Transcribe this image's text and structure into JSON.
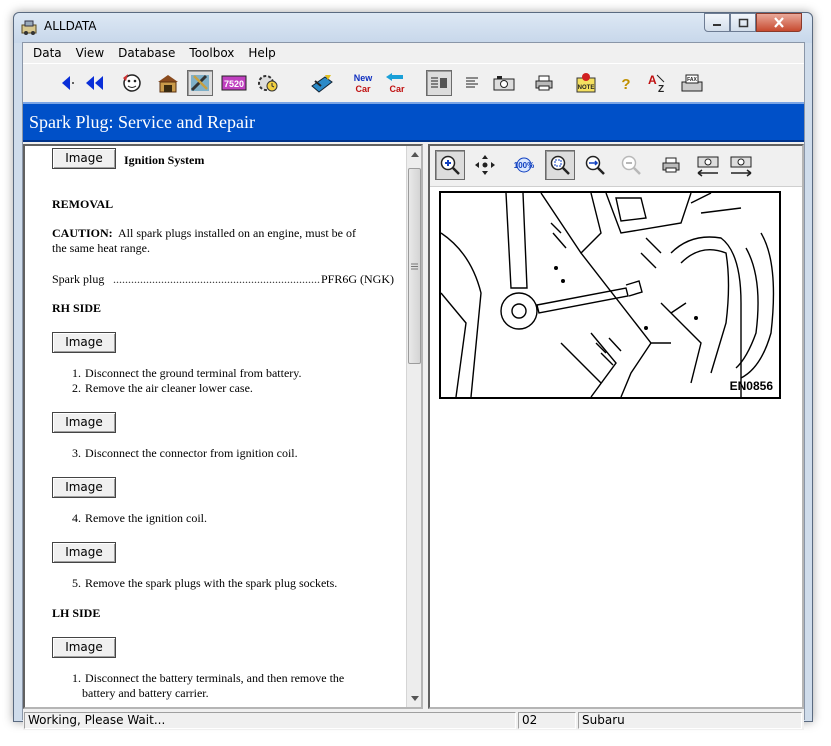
{
  "window": {
    "title": "ALLDATA",
    "app_icon": "alldata-app-icon"
  },
  "menu": [
    {
      "label": "Data"
    },
    {
      "label": "View"
    },
    {
      "label": "Database"
    },
    {
      "label": "Toolbox"
    },
    {
      "label": "Help"
    }
  ],
  "toolbar": {
    "buttons": [
      {
        "icon": "back-arrow-icon"
      },
      {
        "icon": "back-to-start-icon"
      },
      {
        "icon": "technician-face-icon"
      },
      {
        "icon": "garage-icon"
      },
      {
        "icon": "repair-tools-icon",
        "pressed": true
      },
      {
        "icon": "form-7520-icon",
        "text": "7520"
      },
      {
        "icon": "gear-clock-icon"
      },
      {
        "icon": "vehicle-selection-icon"
      },
      {
        "icon": "new-car-icon",
        "text": "New Car"
      },
      {
        "icon": "previous-car-icon",
        "text": "Car"
      },
      {
        "icon": "text-and-image-view-icon",
        "pressed": true
      },
      {
        "icon": "text-view-icon"
      },
      {
        "icon": "image-view-icon"
      },
      {
        "icon": "print-icon"
      },
      {
        "icon": "note-icon",
        "text": "NOTE"
      },
      {
        "icon": "help-icon"
      },
      {
        "icon": "a-to-z-index-icon"
      },
      {
        "icon": "fax-icon",
        "text": "FAX"
      }
    ]
  },
  "document": {
    "title": "Spark Plug:  Service and Repair",
    "image_button_label": "Image",
    "system": "Ignition System",
    "removal_heading": "REMOVAL",
    "caution": "CAUTION:  All spark plugs installed on an engine, must be of the same heat range.",
    "caution_line1": "CAUTION:  All spark plugs installed on an engine, must be of",
    "caution_line2": "the same heat range.",
    "spec_label": "Spark plug",
    "spec_value": "PFR6G (NGK)",
    "rh_heading": "RH SIDE",
    "lh_heading": "LH SIDE",
    "steps": [
      {
        "num": "1.",
        "text": "Disconnect the ground terminal from battery."
      },
      {
        "num": "2.",
        "text": "Remove the air cleaner lower case."
      },
      {
        "num": "3.",
        "text": "Disconnect the connector from ignition coil."
      },
      {
        "num": "4.",
        "text": "Remove the ignition coil."
      },
      {
        "num": "5.",
        "text": "Remove the spark plugs with the spark plug sockets."
      }
    ],
    "lh_steps": [
      {
        "num": "1.",
        "line1": "Disconnect the battery terminals, and then remove the",
        "line2": "battery and battery carrier."
      }
    ]
  },
  "figure_toolbar": {
    "buttons": [
      {
        "icon": "zoom-in-icon",
        "pressed": true
      },
      {
        "icon": "pan-icon"
      },
      {
        "icon": "zoom-100-icon",
        "text": "100%"
      },
      {
        "icon": "zoom-fit-icon",
        "pressed": true
      },
      {
        "icon": "zoom-window-icon"
      },
      {
        "icon": "zoom-out-icon",
        "disabled": true
      },
      {
        "icon": "print-icon"
      },
      {
        "icon": "previous-image-icon"
      },
      {
        "icon": "next-image-icon"
      }
    ]
  },
  "figure": {
    "code": "EN0856"
  },
  "status": {
    "message": "Working,  Please Wait...",
    "code": "02",
    "make": "Subaru"
  }
}
